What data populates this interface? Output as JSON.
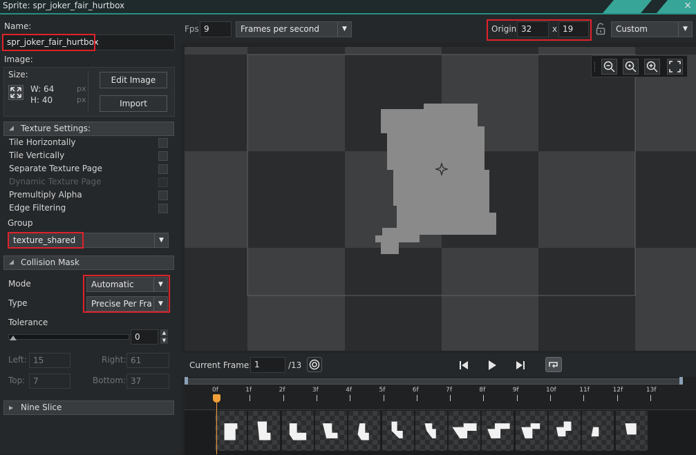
{
  "window": {
    "title": "Sprite: spr_joker_fair_hurtbox",
    "close_glyph": "×"
  },
  "left": {
    "name_label": "Name:",
    "name_value": "spr_joker_fair_hurtbox",
    "image_label": "Image:",
    "size_label": "Size:",
    "width_label": "W: 64",
    "height_label": "H: 40",
    "px1": "px",
    "px2": "px",
    "edit_image": "Edit Image",
    "import": "Import",
    "texture_section": "Texture Settings:",
    "options": [
      {
        "label": "Tile Horizontally",
        "disabled": false
      },
      {
        "label": "Tile Vertically",
        "disabled": false
      },
      {
        "label": "Separate Texture Page",
        "disabled": false
      },
      {
        "label": "Dynamic Texture Page",
        "disabled": true
      },
      {
        "label": "Premultiply Alpha",
        "disabled": false
      },
      {
        "label": "Edge Filtering",
        "disabled": false
      }
    ],
    "group_label": "Group",
    "group_value": "texture_shared",
    "collision_section": "Collision Mask",
    "mode_label": "Mode",
    "mode_value": "Automatic",
    "type_label": "Type",
    "type_value": "Precise Per Frame",
    "tolerance_label": "Tolerance",
    "tolerance_value": "0",
    "left_label": "Left:",
    "left_value": "15",
    "right_label": "Right:",
    "right_value": "61",
    "top_label": "Top:",
    "top_value": "7",
    "bottom_label": "Bottom:",
    "bottom_value": "37",
    "nine_slice": "Nine Slice"
  },
  "toolbar": {
    "fps_label": "Fps",
    "fps_value": "9",
    "fps_mode": "Frames per second",
    "origin_label": "Origin",
    "origin_x": "32",
    "origin_sep": "x",
    "origin_y": "19",
    "origin_preset": "Custom"
  },
  "frames": {
    "current_label": "Current Frame:",
    "current_value": "1",
    "total": "/13",
    "ticks": [
      "0f",
      "1f",
      "2f",
      "3f",
      "4f",
      "5f",
      "6f",
      "7f",
      "8f",
      "9f",
      "10f",
      "11f",
      "12f",
      "13f"
    ]
  },
  "icons": {
    "resize": "resize-arrows-icon",
    "lock": "unlock-icon",
    "zoom_out": "zoom-out-icon",
    "zoom_reset": "zoom-reset-icon",
    "zoom_in": "zoom-in-icon",
    "fit": "fit-screen-icon",
    "prev": "skip-back-icon",
    "play": "play-icon",
    "next": "skip-forward-icon",
    "loop": "loop-icon",
    "onion": "onion-skin-icon"
  },
  "colors": {
    "accent": "#37a598",
    "highlight": "#e0222a",
    "playhead": "#f0a03a"
  }
}
